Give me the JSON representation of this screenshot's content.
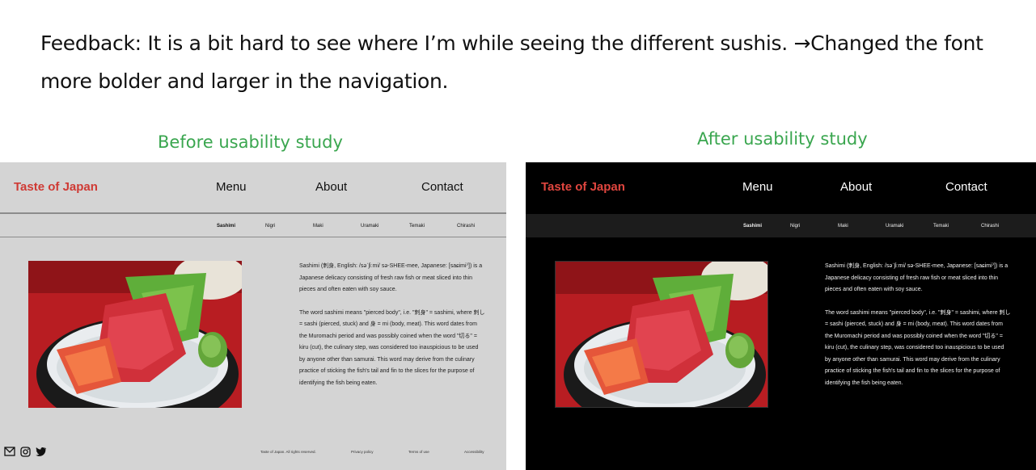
{
  "feedback": {
    "text": "Feedback: It is a bit hard to see where I’m while seeing the different sushis. →Changed the font more bolder and larger in the navigation."
  },
  "captions": {
    "before": "Before usability study",
    "after": "After usability study"
  },
  "site": {
    "brand": "Taste of Japan",
    "nav": [
      "Menu",
      "About",
      "Contact"
    ],
    "subnav": [
      "Sashimi",
      "Nigri",
      "Maki",
      "Uramaki",
      "Temaki",
      "Chirashi"
    ],
    "active_subnav": "Sashimi",
    "description": [
      "Sashimi (刺身, English: /səˈʃiːmi/ sə-SHEE-mee, Japanese: [saɕimiˀ]) is a Japanese delicacy consisting of fresh raw fish or meat sliced into thin pieces and often eaten with soy sauce.",
      "The word sashimi means \"pierced body\", i.e. \"刺身\" = sashimi, where 刺し = sashi (pierced, stuck) and 身 = mi (body, meat). This word dates from the Muromachi period and was possibly coined when the word \"切る\" = kiru (cut), the culinary step, was considered too inauspicious to be used by anyone other than samurai. This word may derive from the culinary practice of sticking the fish's tail and fin to the slices for the purpose of identifying the fish being eaten."
    ],
    "footer_links": [
      "Taste of Japan. All rights reserved.",
      "Privacy policy",
      "Terms of use",
      "Accessibility"
    ],
    "footer_icons": [
      "mail-icon",
      "instagram-icon",
      "twitter-icon"
    ]
  },
  "colors": {
    "caption": "#3aa64f",
    "brand_before": "#cf3a34",
    "brand_after": "#e0463f",
    "before_bg": "#d4d4d4",
    "after_bg": "#000000"
  }
}
